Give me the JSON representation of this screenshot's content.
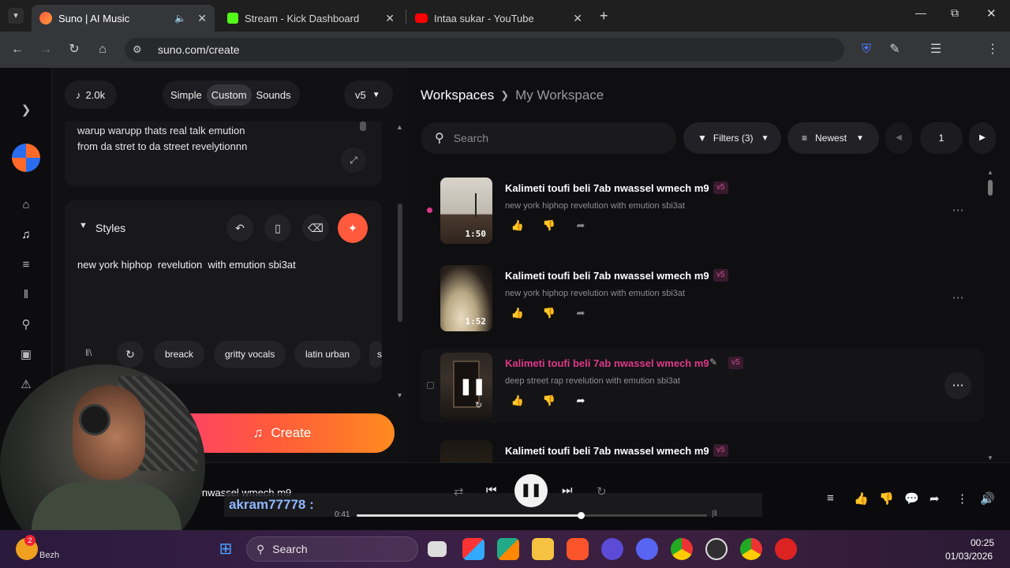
{
  "browser": {
    "tabs": [
      {
        "title": "Suno | AI Music",
        "active": true
      },
      {
        "title": "Stream - Kick Dashboard",
        "active": false
      },
      {
        "title": "Intaa sukar - YouTube",
        "active": false
      }
    ],
    "url": "suno.com/create"
  },
  "left": {
    "credits": "2.0k",
    "modes": [
      "Simple",
      "Custom",
      "Sounds"
    ],
    "active_mode": "Custom",
    "version": "v5",
    "lyrics_lines": [
      "warup warupp thats real talk emution",
      "from da stret to da street revelytionnn"
    ],
    "styles_label": "Styles",
    "styles_text": "new york hiphop  revelution  with emution sbi3at",
    "tags": [
      "breack",
      "gritty vocals",
      "latin urban",
      "s"
    ],
    "create_label": "Create"
  },
  "right": {
    "breadcrumb": {
      "root": "Workspaces",
      "current": "My Workspace"
    },
    "search_placeholder": "Search",
    "filters_label": "Filters (3)",
    "sort_label": "Newest",
    "page": "1",
    "songs": [
      {
        "title": "Kalimeti toufi beli 7ab nwassel wmech m9",
        "version": "v5",
        "desc": "new york hiphop revelution with emution sbi3at",
        "duration": "1:50",
        "highlight": false,
        "playing": false
      },
      {
        "title": "Kalimeti toufi beli 7ab nwassel wmech m9",
        "version": "v5",
        "desc": "new york hiphop revelution with emution sbi3at",
        "duration": "1:52",
        "highlight": false,
        "playing": false
      },
      {
        "title": "Kalimeti toufi beli 7ab nwassel wmech m9",
        "version": "v5",
        "desc": "deep street rap revelution with emution sbi3at",
        "duration": "",
        "highlight": true,
        "playing": true
      },
      {
        "title": "Kalimeti toufi beli 7ab nwassel wmech m9",
        "version": "v5",
        "desc": "",
        "duration": "",
        "highlight": false,
        "playing": false
      }
    ]
  },
  "player": {
    "now_playing": "o nwassel wmech m9",
    "overlay_user": "akram77778 :",
    "elapsed": "0:41",
    "progress": 0.64
  },
  "taskbar": {
    "search_label": "Search",
    "badge": "2",
    "weather_partial": "Bezh",
    "time": "00:25",
    "date": "01/03/2026"
  },
  "colors": {
    "accent_pink": "#e0388a",
    "create_gradient_start": "#ff3f6c",
    "create_gradient_end": "#ff8a1f"
  }
}
